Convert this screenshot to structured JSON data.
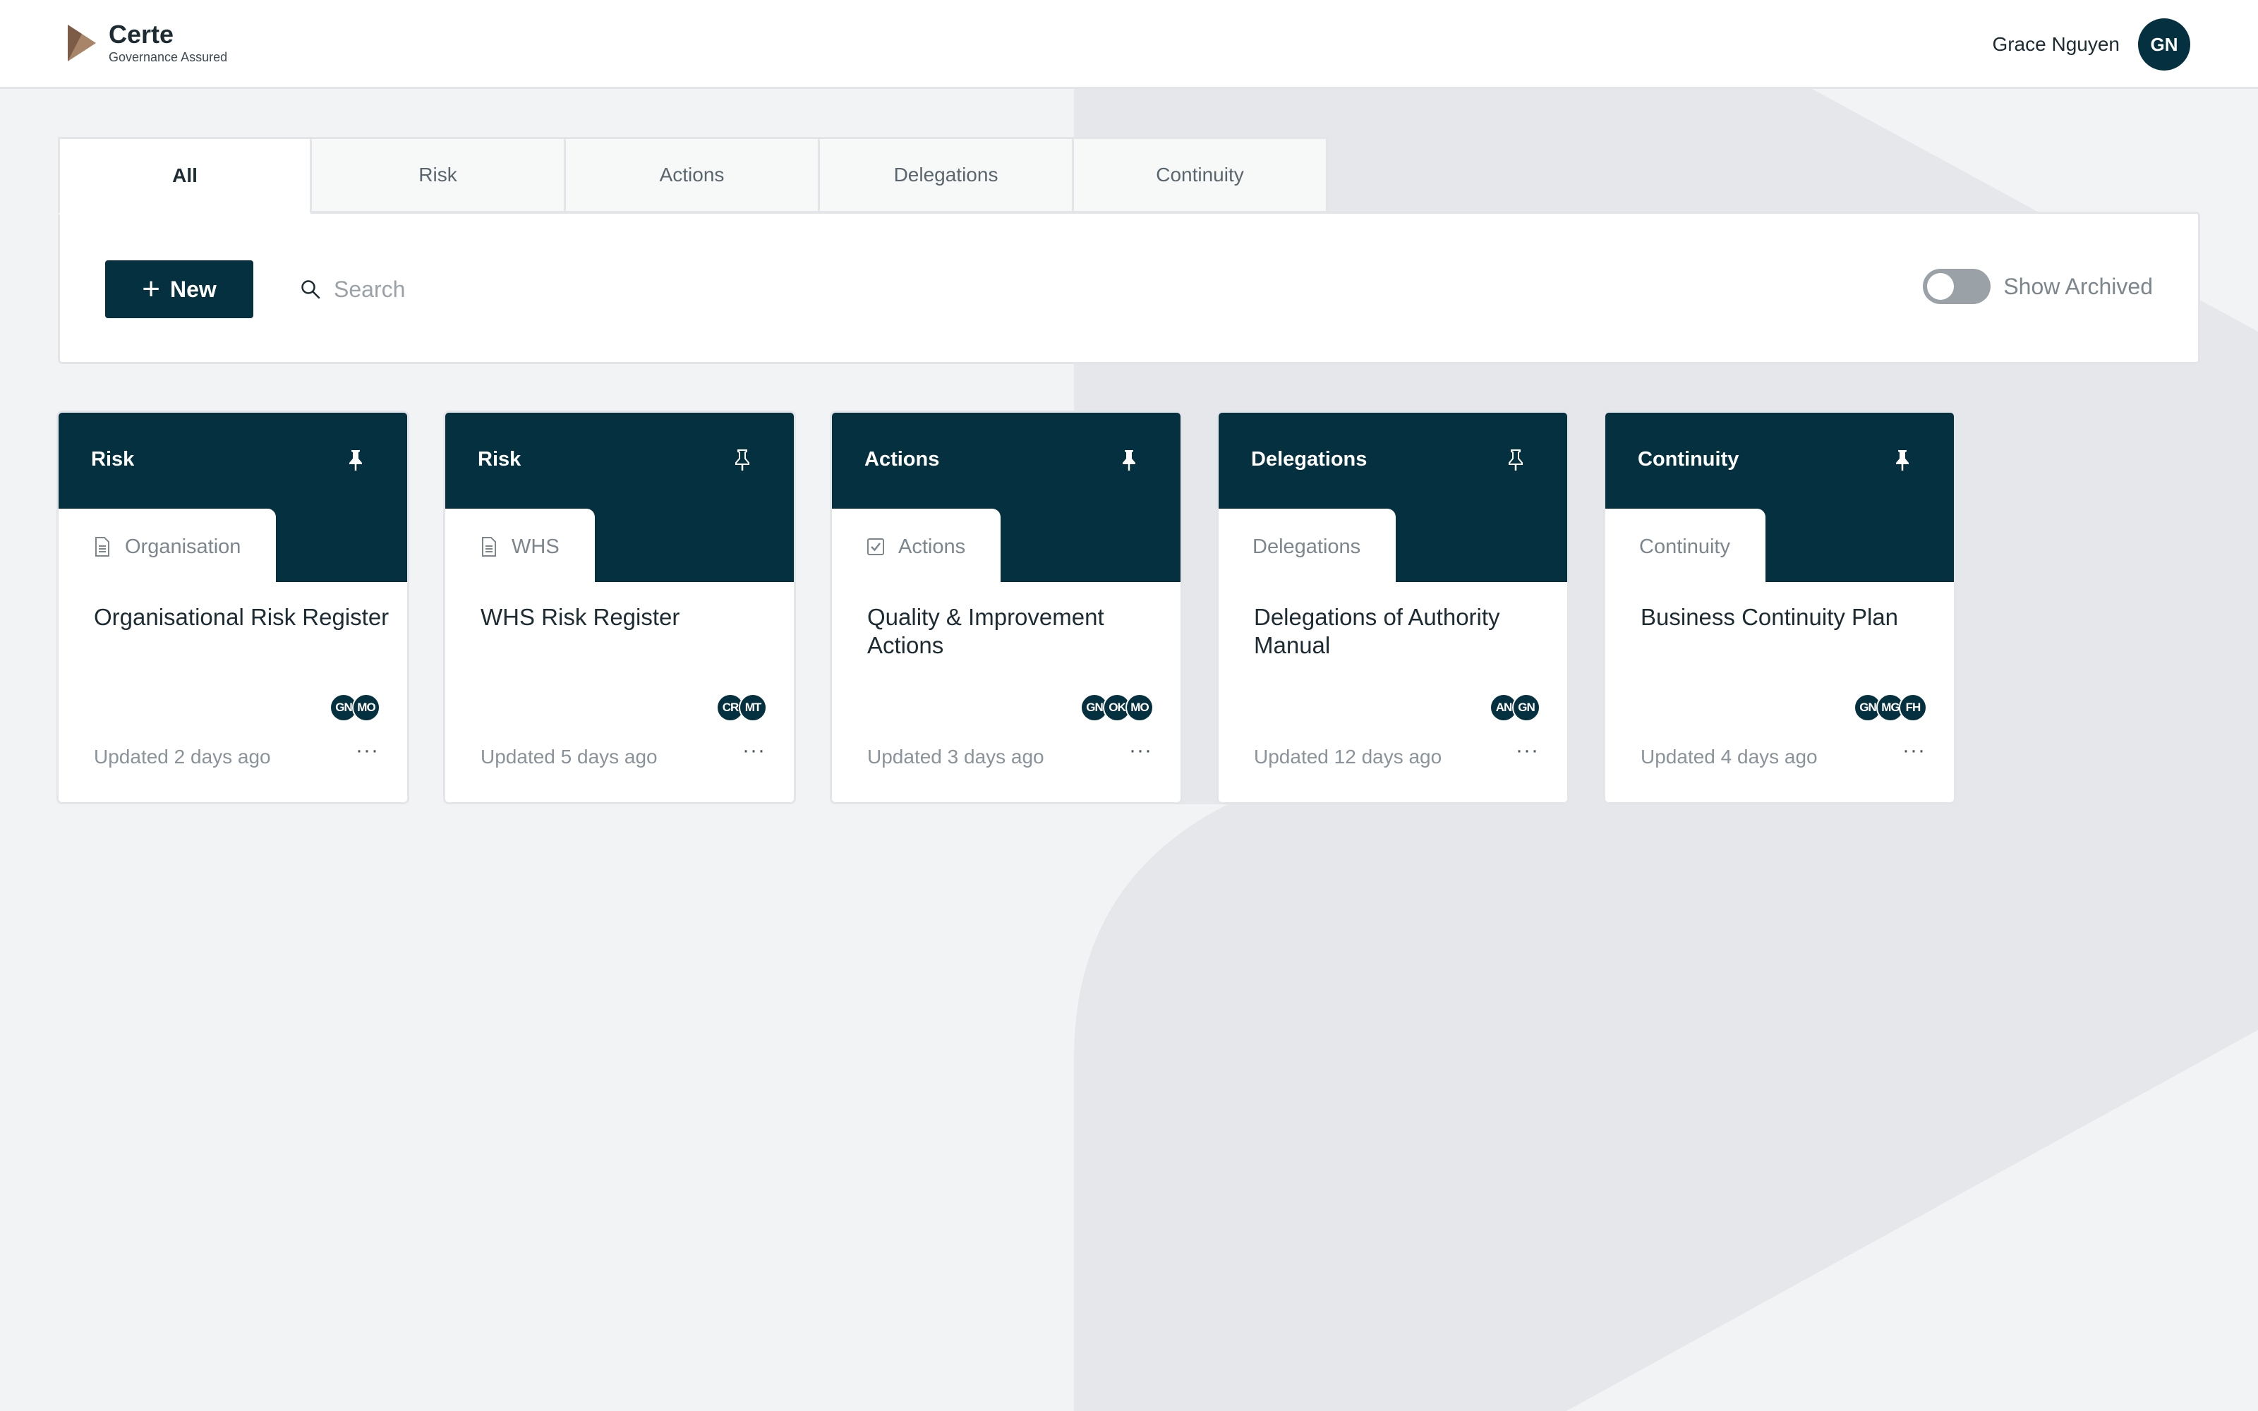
{
  "brand": {
    "name": "Certe",
    "tagline": "Governance Assured"
  },
  "user": {
    "name": "Grace Nguyen",
    "initials": "GN"
  },
  "tabs": [
    {
      "label": "All",
      "active": true
    },
    {
      "label": "Risk"
    },
    {
      "label": "Actions"
    },
    {
      "label": "Delegations"
    },
    {
      "label": "Continuity"
    }
  ],
  "toolbar": {
    "new_label": "New",
    "search_placeholder": "Search",
    "archived_label": "Show Archived",
    "archived_on": false
  },
  "cards": [
    {
      "type": "Risk",
      "tab_label": "Organisation",
      "tab_icon": "document-icon",
      "title": "Organisational Risk Register",
      "avatars": [
        "GN",
        "MO"
      ],
      "updated": "Updated 2 days ago",
      "pinned": true
    },
    {
      "type": "Risk",
      "tab_label": "WHS",
      "tab_icon": "document-icon",
      "title": "WHS Risk Register",
      "avatars": [
        "CR",
        "MT"
      ],
      "updated": "Updated 5 days ago",
      "pinned": false
    },
    {
      "type": "Actions",
      "tab_label": "Actions",
      "tab_icon": "checkbox-icon",
      "title": "Quality & Improvement Actions",
      "avatars": [
        "GN",
        "OK",
        "MO"
      ],
      "updated": "Updated 3 days ago",
      "pinned": true
    },
    {
      "type": "Delegations",
      "tab_label": "Delegations",
      "tab_icon": "",
      "title": "Delegations of Authority Manual",
      "avatars": [
        "AN",
        "GN"
      ],
      "updated": "Updated 12 days ago",
      "pinned": false
    },
    {
      "type": "Continuity",
      "tab_label": "Continuity",
      "tab_icon": "",
      "title": "Business Continuity Plan",
      "avatars": [
        "GN",
        "MG",
        "FH"
      ],
      "updated": "Updated 4 days ago",
      "pinned": true
    }
  ],
  "colors": {
    "primary": "#04303f",
    "background": "#f2f3f5",
    "logo_accent": "#a88468"
  }
}
